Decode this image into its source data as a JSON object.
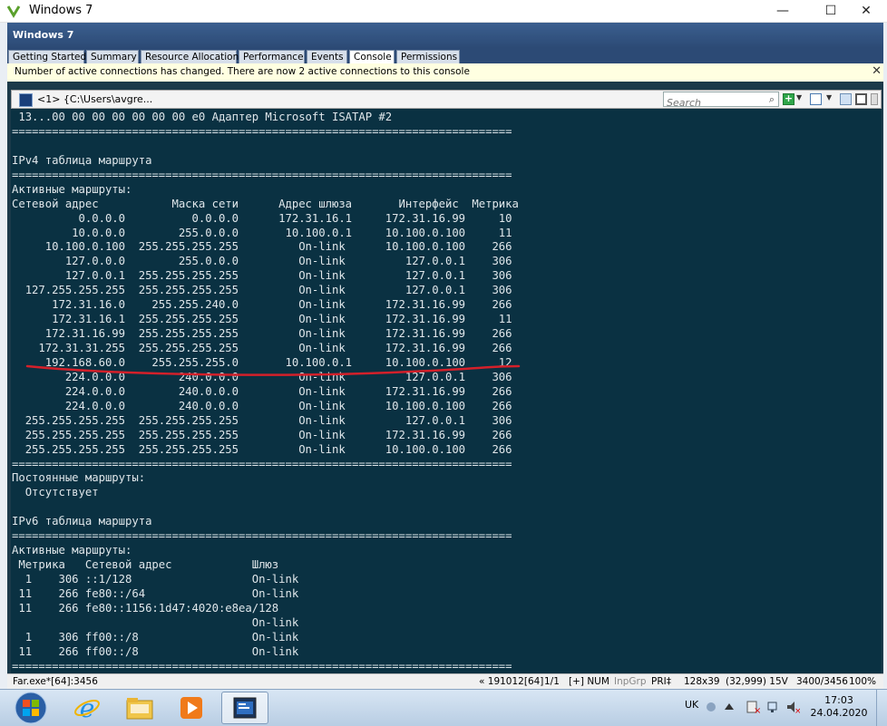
{
  "window": {
    "title": "Windows 7",
    "minimize": "—",
    "maximize": "☐",
    "close": "✕"
  },
  "vm_header": {
    "name": "Windows 7"
  },
  "tabs": [
    {
      "label": "Getting Started"
    },
    {
      "label": "Summary"
    },
    {
      "label": "Resource Allocation"
    },
    {
      "label": "Performance"
    },
    {
      "label": "Events"
    },
    {
      "label": "Console"
    },
    {
      "label": "Permissions"
    }
  ],
  "active_tab": "Console",
  "info_bar": {
    "message": "Number of active connections has changed. There are now 2 active connections to this console",
    "close": "✕"
  },
  "conemu": {
    "tab_label": "<1>  {C:\\Users\\avgre...",
    "search_placeholder": "Search"
  },
  "terminal_lines": [
    " 13...00 00 00 00 00 00 00 e0 Адаптер Microsoft ISATAP #2",
    "===========================================================================",
    "",
    "IPv4 таблица маршрута",
    "===========================================================================",
    "Активные маршруты:",
    "Сетевой адрес           Маска сети      Адрес шлюза       Интерфейс  Метрика",
    "          0.0.0.0          0.0.0.0      172.31.16.1     172.31.16.99     10",
    "         10.0.0.0        255.0.0.0       10.100.0.1     10.100.0.100     11",
    "     10.100.0.100  255.255.255.255         On-link      10.100.0.100    266",
    "        127.0.0.0        255.0.0.0         On-link         127.0.0.1    306",
    "        127.0.0.1  255.255.255.255         On-link         127.0.0.1    306",
    "  127.255.255.255  255.255.255.255         On-link         127.0.0.1    306",
    "      172.31.16.0    255.255.240.0         On-link      172.31.16.99    266",
    "      172.31.16.1  255.255.255.255         On-link      172.31.16.99     11",
    "     172.31.16.99  255.255.255.255         On-link      172.31.16.99    266",
    "    172.31.31.255  255.255.255.255         On-link      172.31.16.99    266",
    "     192.168.60.0    255.255.255.0       10.100.0.1     10.100.0.100     12",
    "        224.0.0.0        240.0.0.0         On-link         127.0.0.1    306",
    "        224.0.0.0        240.0.0.0         On-link      172.31.16.99    266",
    "        224.0.0.0        240.0.0.0         On-link      10.100.0.100    266",
    "  255.255.255.255  255.255.255.255         On-link         127.0.0.1    306",
    "  255.255.255.255  255.255.255.255         On-link      172.31.16.99    266",
    "  255.255.255.255  255.255.255.255         On-link      10.100.0.100    266",
    "===========================================================================",
    "Постоянные маршруты:",
    "  Отсутствует",
    "",
    "IPv6 таблица маршрута",
    "===========================================================================",
    "Активные маршруты:",
    " Метрика   Сетевой адрес            Шлюз",
    "  1    306 ::1/128                  On-link",
    " 11    266 fe80::/64                On-link",
    " 11    266 fe80::1156:1d47:4020:e8ea/128",
    "                                    On-link",
    "  1    306 ff00::/8                 On-link",
    " 11    266 ff00::/8                 On-link",
    "==========================================================================="
  ],
  "status_bar": {
    "process": "Far.exe*[64]:3456",
    "build": "« 191012[64]",
    "pos": "1/1",
    "mode": "[+] NUM",
    "inpgrp": "InpGrp",
    "pri": "PRI‡",
    "size": "128x39",
    "coords": "(32,999) 15V",
    "proc": "3400/3456",
    "zoom": "100%"
  },
  "taskbar": {
    "lang": "UK",
    "time": "17:03",
    "date": "24.04.2020"
  },
  "colors": {
    "terminal_bg": "#0a3142",
    "terminal_fg": "#dfe6ea",
    "annotation": "#d4202a"
  }
}
